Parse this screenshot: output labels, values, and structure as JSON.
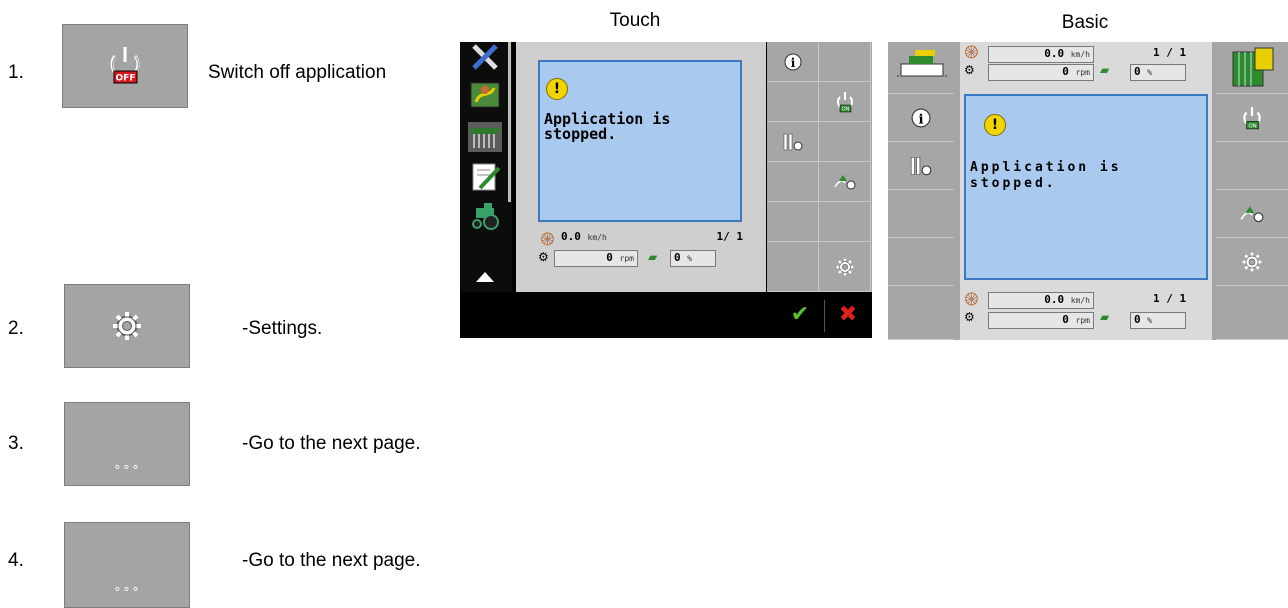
{
  "steps": [
    {
      "num": "1.",
      "icon": "power-off-icon",
      "text": "Switch off application"
    },
    {
      "num": "2.",
      "icon": "gear-icon",
      "text": "-Settings."
    },
    {
      "num": "3.",
      "icon": "more-icon",
      "text": "-Go to the next page."
    },
    {
      "num": "4.",
      "icon": "more-icon",
      "text": "-Go to the next page."
    }
  ],
  "headings": {
    "touch": "Touch",
    "basic": "Basic"
  },
  "touch": {
    "message": "Application is stopped.",
    "speed": "0.0",
    "speed_unit": "km/h",
    "rpm": "0",
    "rpm_unit": "rpm",
    "percent": "0",
    "percent_unit": "%",
    "section": "1/ 1",
    "icons": [
      "tools-icon",
      "field-map-icon",
      "implement-icon",
      "checklist-icon",
      "tractor-icon",
      "arrow-up-icon",
      "arrow-down-icon"
    ],
    "softkeys": [
      "info-icon",
      "power-on-icon",
      "section-settings-icon",
      "flow-icon",
      "gear-icon"
    ],
    "confirm": "✔",
    "cancel": "✖"
  },
  "basic": {
    "message": "Application is stopped.",
    "speed": "0.0",
    "speed_unit": "km/h",
    "rpm": "0",
    "rpm_unit": "rpm",
    "percent": "0",
    "percent_unit": "%",
    "section": "1 / 1",
    "softkeys": [
      "info-icon",
      "section-settings-icon",
      "power-on-icon",
      "flow-icon",
      "gear-icon"
    ]
  },
  "colors": {
    "key_bg": "#a4a4a4",
    "msg_bg": "#a9c9ee",
    "msg_border": "#3a78c6",
    "off_red": "#d9181e",
    "on_green": "#2d8a2d"
  }
}
